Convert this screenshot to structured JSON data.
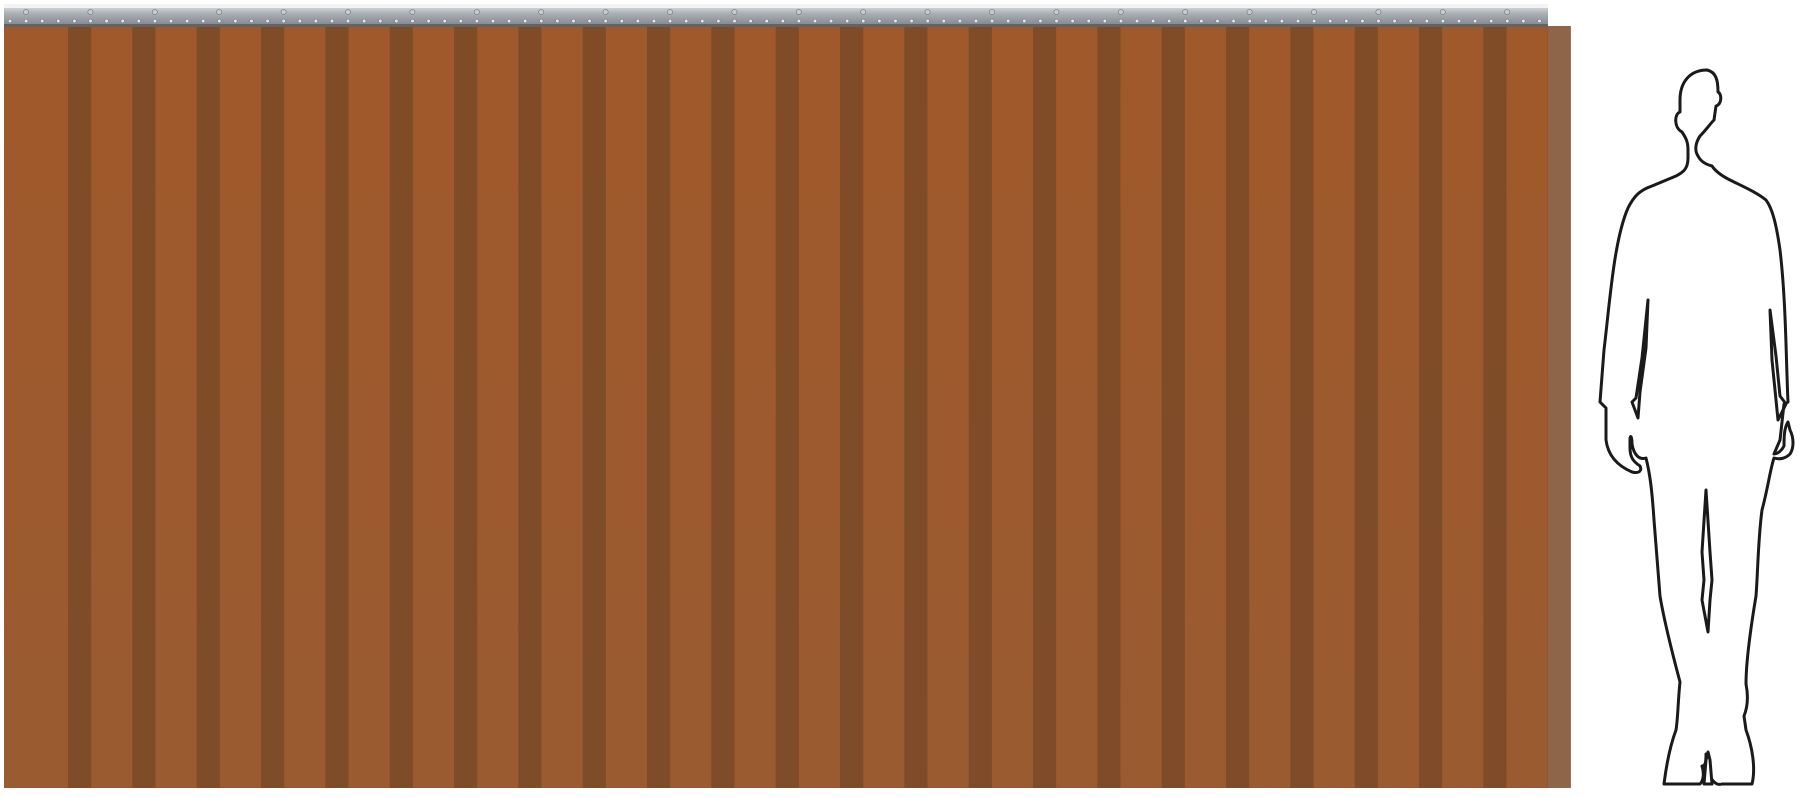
{
  "scene": {
    "subject": "pvc-strip-curtain",
    "scale_reference": "human-silhouette"
  },
  "curtain": {
    "strip_count": 24,
    "strip_color": "#9a5a2e",
    "overlap_color": "#7a4a28",
    "rail_color": "#9aa0a4",
    "rail_highlight": "#d9dcde",
    "bolt_color": "#c8cbcd"
  },
  "figure": {
    "outline_color": "#1a1a1a",
    "fill_color": "#ffffff"
  }
}
